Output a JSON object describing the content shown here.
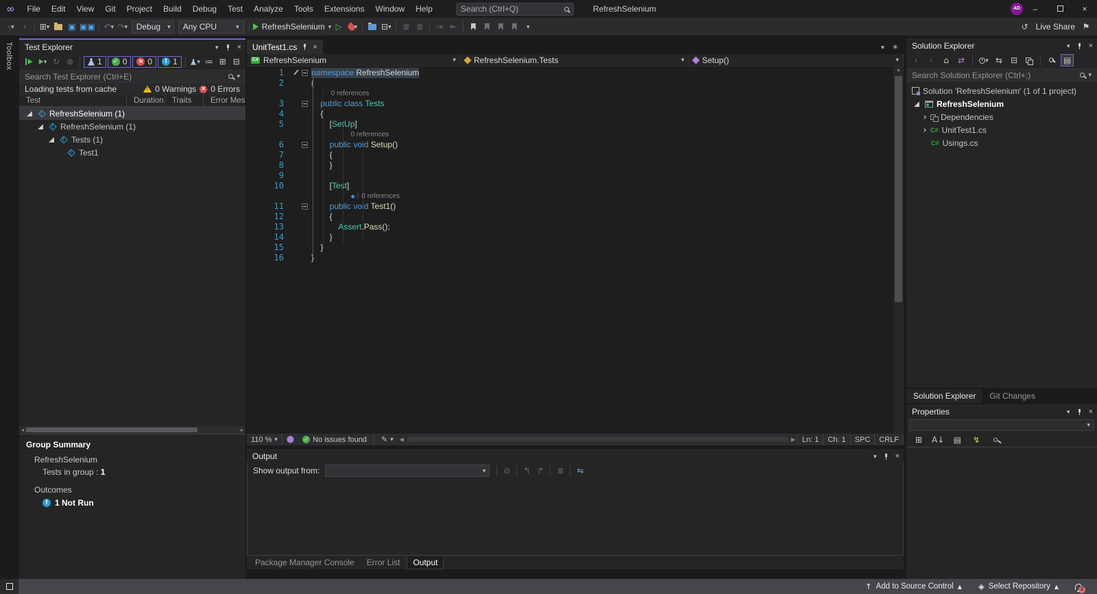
{
  "colors": {
    "accent_purple": "#6F66D9",
    "run_green": "#4FC24F",
    "error_red": "#E14C4C",
    "notrun_blue": "#2D9CDB",
    "warning_yellow": "#FFCC00",
    "keyword_blue": "#569CD6",
    "type_teal": "#4EC9B0",
    "method_yellow": "#DCDCAA",
    "avatar_purple": "#881798"
  },
  "titlebar": {
    "menus": [
      "File",
      "Edit",
      "View",
      "Git",
      "Project",
      "Build",
      "Debug",
      "Test",
      "Analyze",
      "Tools",
      "Extensions",
      "Window",
      "Help"
    ],
    "search_placeholder": "Search (Ctrl+Q)",
    "title": "RefreshSelenium",
    "avatar": "AD"
  },
  "toolbar": {
    "config": "Debug",
    "platform": "Any CPU",
    "run_target": "RefreshSelenium",
    "live_share": "Live Share"
  },
  "toolbox": {
    "tab": "Toolbox"
  },
  "test_explorer": {
    "title": "Test Explorer",
    "counts": {
      "total": "1",
      "passed": "0",
      "failed": "0",
      "notrun": "1"
    },
    "search_placeholder": "Search Test Explorer (Ctrl+E)",
    "status_text": "Loading tests from cache",
    "warnings": "0 Warnings",
    "errors": "0 Errors",
    "columns": [
      "Test",
      "Duration",
      "Traits",
      "Error Mes"
    ],
    "tree": [
      {
        "label": "RefreshSelenium (1)",
        "indent": 0,
        "arrow": true,
        "selected": true
      },
      {
        "label": "RefreshSelenium (1)",
        "indent": 1,
        "arrow": true
      },
      {
        "label": "Tests (1)",
        "indent": 2,
        "arrow": true
      },
      {
        "label": "Test1",
        "indent": 3,
        "arrow": false
      }
    ],
    "group_summary": {
      "heading": "Group Summary",
      "group_name": "RefreshSelenium",
      "tests_in_group_label": "Tests in group :",
      "tests_in_group_value": "1",
      "outcomes_label": "Outcomes",
      "outcome_value": "1 Not Run"
    }
  },
  "editor": {
    "tab_title": "UnitTest1.cs",
    "breadcrumbs": [
      "RefreshSelenium",
      "RefreshSelenium.Tests",
      "Setup()"
    ],
    "code": [
      {
        "t": "c",
        "n": "1",
        "fold": true,
        "pen": true,
        "hl": true,
        "tok": [
          [
            "kw",
            "namespace"
          ],
          [
            "pl",
            " RefreshSelenium"
          ]
        ]
      },
      {
        "t": "c",
        "n": "2",
        "tok": [
          [
            "pl",
            "{"
          ]
        ]
      },
      {
        "t": "l",
        "ind": 4,
        "text": "0 references"
      },
      {
        "t": "c",
        "n": "3",
        "fold": true,
        "tok": [
          [
            "pl",
            "    "
          ],
          [
            "kw",
            "public"
          ],
          [
            "pl",
            " "
          ],
          [
            "kw",
            "class"
          ],
          [
            "pl",
            " "
          ],
          [
            "ty",
            "Tests"
          ]
        ]
      },
      {
        "t": "c",
        "n": "4",
        "tok": [
          [
            "pl",
            "    {"
          ]
        ]
      },
      {
        "t": "c",
        "n": "5",
        "tok": [
          [
            "pl",
            "        ["
          ],
          [
            "ty",
            "SetUp"
          ],
          [
            "pl",
            "]"
          ]
        ]
      },
      {
        "t": "l",
        "ind": 8,
        "text": "0 references"
      },
      {
        "t": "c",
        "n": "6",
        "fold": true,
        "tok": [
          [
            "pl",
            "        "
          ],
          [
            "kw",
            "public"
          ],
          [
            "pl",
            " "
          ],
          [
            "kw",
            "void"
          ],
          [
            "pl",
            " "
          ],
          [
            "me",
            "Setup"
          ],
          [
            "pl",
            "()"
          ]
        ]
      },
      {
        "t": "c",
        "n": "7",
        "tok": [
          [
            "pl",
            "        {"
          ]
        ]
      },
      {
        "t": "c",
        "n": "8",
        "tok": [
          [
            "pl",
            "        }"
          ]
        ]
      },
      {
        "t": "c",
        "n": "9",
        "tok": []
      },
      {
        "t": "c",
        "n": "10",
        "tok": [
          [
            "pl",
            "        ["
          ],
          [
            "ty",
            "Test"
          ],
          [
            "pl",
            "]"
          ]
        ]
      },
      {
        "t": "l",
        "ind": 8,
        "icon": true,
        "text": "0 references"
      },
      {
        "t": "c",
        "n": "11",
        "fold": true,
        "tok": [
          [
            "pl",
            "        "
          ],
          [
            "kw",
            "public"
          ],
          [
            "pl",
            " "
          ],
          [
            "kw",
            "void"
          ],
          [
            "pl",
            " "
          ],
          [
            "me",
            "Test1"
          ],
          [
            "pl",
            "()"
          ]
        ]
      },
      {
        "t": "c",
        "n": "12",
        "tok": [
          [
            "pl",
            "        {"
          ]
        ]
      },
      {
        "t": "c",
        "n": "13",
        "tok": [
          [
            "pl",
            "            "
          ],
          [
            "ty",
            "Assert"
          ],
          [
            "pl",
            "."
          ],
          [
            "me",
            "Pass"
          ],
          [
            "pl",
            "();"
          ]
        ]
      },
      {
        "t": "c",
        "n": "14",
        "tok": [
          [
            "pl",
            "        }"
          ]
        ]
      },
      {
        "t": "c",
        "n": "15",
        "tok": [
          [
            "pl",
            "    }"
          ]
        ]
      },
      {
        "t": "c",
        "n": "16",
        "tok": [
          [
            "pl",
            "}"
          ]
        ]
      }
    ],
    "status": {
      "zoom": "110 %",
      "issues": "No issues found",
      "ln": "Ln: 1",
      "ch": "Ch: 1",
      "spc": "SPC",
      "eol": "CRLF"
    }
  },
  "output": {
    "title": "Output",
    "show_output_from": "Show output from:",
    "tabs": [
      {
        "label": "Package Manager Console",
        "active": false
      },
      {
        "label": "Error List",
        "active": false
      },
      {
        "label": "Output",
        "active": true
      }
    ]
  },
  "solution_explorer": {
    "title": "Solution Explorer",
    "search_placeholder": "Search Solution Explorer (Ctrl+;)",
    "tree": [
      {
        "label": "Solution 'RefreshSelenium' (1 of 1 project)",
        "icon": "solution",
        "indent": 0,
        "arrow": "none"
      },
      {
        "label": "RefreshSelenium",
        "icon": "project",
        "indent": 0,
        "arrow": "exp",
        "bold": true
      },
      {
        "label": "Dependencies",
        "icon": "dep",
        "indent": 1,
        "arrow": "col"
      },
      {
        "label": "UnitTest1.cs",
        "icon": "cs",
        "indent": 1,
        "arrow": "col"
      },
      {
        "label": "Usings.cs",
        "icon": "cs",
        "indent": 1,
        "arrow": "none2"
      }
    ],
    "tabs": [
      {
        "label": "Solution Explorer",
        "active": true
      },
      {
        "label": "Git Changes",
        "active": false
      }
    ]
  },
  "properties": {
    "title": "Properties"
  },
  "statusbar": {
    "add_to_source_control": "Add to Source Control",
    "select_repository": "Select Repository",
    "notification_count": "2"
  }
}
